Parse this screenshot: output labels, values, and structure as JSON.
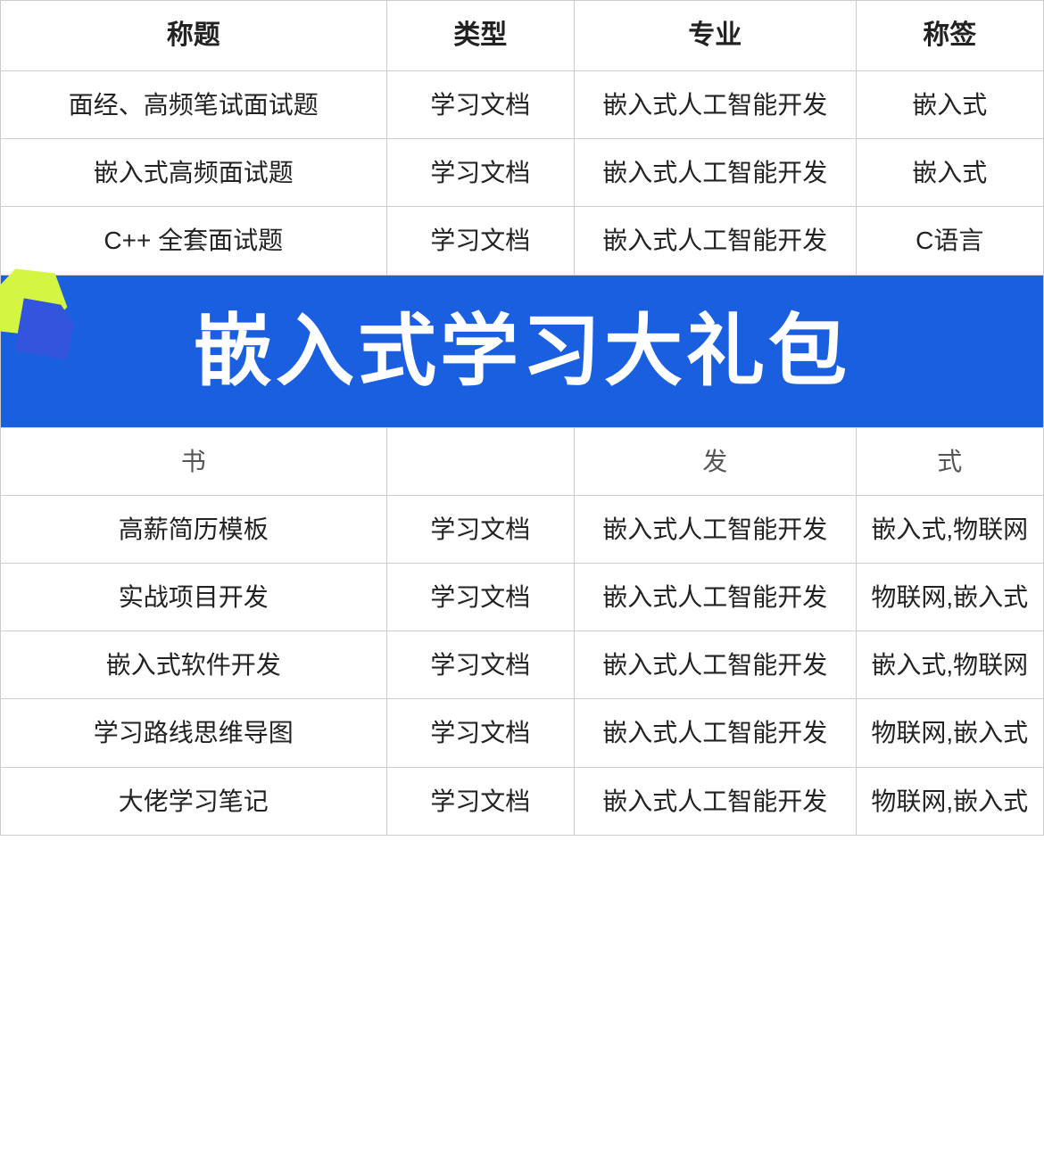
{
  "headers": {
    "col1": "称题",
    "col2": "类型",
    "col3": "专业",
    "col4": "称签"
  },
  "banner": {
    "text": "嵌入式学习大礼包"
  },
  "rows": [
    {
      "title": "面经、高频笔试面试题",
      "type": "学习文档",
      "major": "嵌入式人工智能开发",
      "tag": "嵌入式"
    },
    {
      "title": "嵌入式高频面试题",
      "type": "学习文档",
      "major": "嵌入式人工智能开发",
      "tag": "嵌入式"
    },
    {
      "title": "C++ 全套面试题",
      "type": "学习文档",
      "major": "嵌入式人工智能开发",
      "tag": "C语言"
    },
    {
      "title": "banner",
      "type": "",
      "major": "",
      "tag": ""
    },
    {
      "title": "书",
      "type": "",
      "major": "发",
      "tag": "式",
      "partial": true
    },
    {
      "title": "高薪简历模板",
      "type": "学习文档",
      "major": "嵌入式人工智能开发",
      "tag": "嵌入式,物联网"
    },
    {
      "title": "实战项目开发",
      "type": "学习文档",
      "major": "嵌入式人工智能开发",
      "tag": "物联网,嵌入式"
    },
    {
      "title": "嵌入式软件开发",
      "type": "学习文档",
      "major": "嵌入式人工智能开发",
      "tag": "嵌入式,物联网"
    },
    {
      "title": "学习路线思维导图",
      "type": "学习文档",
      "major": "嵌入式人工智能开发",
      "tag": "物联网,嵌入式"
    },
    {
      "title": "大佬学习笔记",
      "type": "学习文档",
      "major": "嵌入式人工智能开发",
      "tag": "物联网,嵌入式"
    }
  ]
}
